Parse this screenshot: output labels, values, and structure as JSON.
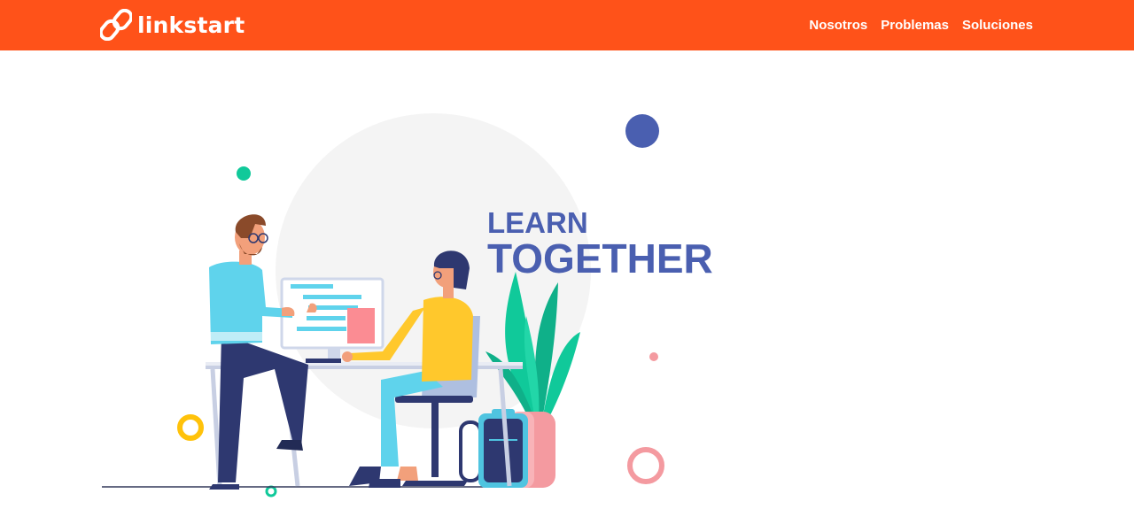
{
  "brand": {
    "name": "linkstart",
    "icon": "link-chain-icon"
  },
  "nav": {
    "items": [
      {
        "label": "Nosotros"
      },
      {
        "label": "Problemas"
      },
      {
        "label": "Soluciones"
      }
    ]
  },
  "hero": {
    "illustration": "learn-together-illustration",
    "headline_line1": "LEARN",
    "headline_line2": "TOGETHER"
  },
  "colors": {
    "navbar": "#ff5219",
    "headline": "#4a5fb0",
    "accent_green": "#10c99a",
    "accent_yellow": "#ffc20a",
    "accent_pink": "#f49aa0"
  }
}
